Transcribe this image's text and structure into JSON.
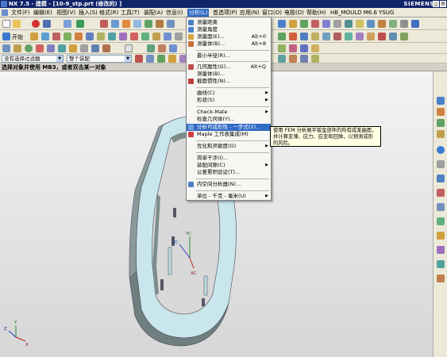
{
  "title_bar": {
    "title": "NX 7.5 - 建模 - [10-9_stp.prt (修改的) ]",
    "brand": "SIEMENS"
  },
  "menu_bar": {
    "items": [
      "文件(F)",
      "编辑(E)",
      "视图(V)",
      "插入(S)",
      "格式(R)",
      "工具(T)",
      "装配(A)",
      "信息(I)",
      "分析(L)",
      "首选项(P)",
      "应用(N)",
      "窗口(O)",
      "电极(D)",
      "帮助(H)",
      "HB_MOULD M6.6",
      "YSUG"
    ]
  },
  "toolbar": {
    "start_label": "开始",
    "filter_value": "没有选择过滤器",
    "assembly_value": "整个装配"
  },
  "status": {
    "prompt": "选择对象并使用 MB3，或者双击某一对象"
  },
  "analysis_menu": {
    "items": [
      {
        "label": "测量距离",
        "shortcut": "",
        "arrow": false,
        "icon": "#4a7fc7"
      },
      {
        "label": "测量角度",
        "shortcut": "",
        "arrow": false,
        "icon": "#4a7fc7"
      },
      {
        "label": "测量面(E)...",
        "shortcut": "Alt+0",
        "arrow": false,
        "icon": "#d9a441"
      },
      {
        "label": "测量体(B)...",
        "shortcut": "Alt+8",
        "arrow": false,
        "icon": "#c96d3a"
      },
      {
        "label": "最小半径(R)...",
        "shortcut": "",
        "arrow": false,
        "icon": ""
      },
      {
        "label": "几何属性(G)...",
        "shortcut": "Alt+Q",
        "arrow": false,
        "icon": "#c05050"
      },
      {
        "label": "测量体(B)...",
        "shortcut": "",
        "arrow": false,
        "icon": ""
      },
      {
        "label": "截面惯性(N)...",
        "shortcut": "",
        "arrow": false,
        "icon": "#c04040"
      },
      {
        "label": "曲线(C)",
        "shortcut": "",
        "arrow": true,
        "icon": ""
      },
      {
        "label": "形状(S)",
        "shortcut": "",
        "arrow": true,
        "icon": ""
      },
      {
        "label": "Check-Mate",
        "shortcut": "",
        "arrow": true,
        "icon": ""
      },
      {
        "label": "检查几何体(Y)...",
        "shortcut": "",
        "arrow": false,
        "icon": ""
      },
      {
        "label": "分析可成形性 - 一步式(2)...",
        "shortcut": "",
        "arrow": false,
        "icon": "#6fa0e0"
      },
      {
        "label": "Maple 工作表集成(M)",
        "shortcut": "",
        "arrow": false,
        "icon": "#d04040"
      },
      {
        "label": "优化和灵敏度(O)",
        "shortcut": "",
        "arrow": true,
        "icon": ""
      },
      {
        "label": "简单干涉(I)...",
        "shortcut": "",
        "arrow": false,
        "icon": ""
      },
      {
        "label": "装配间隙(C)",
        "shortcut": "",
        "arrow": true,
        "icon": ""
      },
      {
        "label": "公差累积验证(T)...",
        "shortcut": "",
        "arrow": false,
        "icon": ""
      },
      {
        "label": "内空间分析器(N)...",
        "shortcut": "",
        "arrow": false,
        "icon": "#5080c0"
      },
      {
        "label": "单位 - 千克 - 毫米(U)",
        "shortcut": "",
        "arrow": true,
        "icon": ""
      }
    ]
  },
  "tooltip": {
    "text": "使用 FEM 分析展平钣金部件的所有成某曲面，并计算变薄、应力、应变和回弹，以预测成形的风险。"
  },
  "axes": {
    "x": "XC",
    "y": "YC",
    "z": "ZC",
    "corner_x": "X",
    "corner_y": "Y",
    "corner_z": "Z"
  },
  "colors": {
    "accent": "#316ac5",
    "title_bar": "#10246a",
    "part_face": "#c9e6ec",
    "part_side": "#7f8f8f"
  }
}
